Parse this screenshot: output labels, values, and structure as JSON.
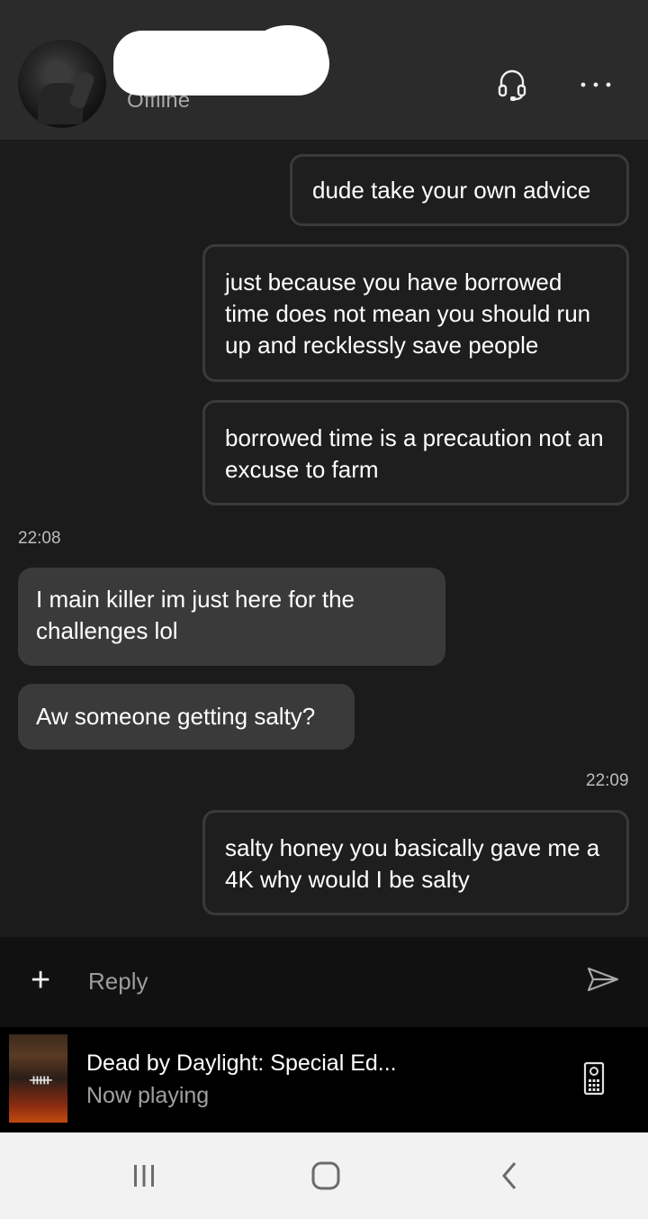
{
  "header": {
    "contact_status": "Offline"
  },
  "messages": [
    {
      "direction": "out",
      "text": "dude take your own advice"
    },
    {
      "direction": "out",
      "text": "just because you have borrowed time does not mean you should run up and recklessly save people"
    },
    {
      "direction": "out",
      "text": "borrowed time is a precaution not an excuse to farm"
    },
    {
      "timestamp": "22:08"
    },
    {
      "direction": "in",
      "text": "I main killer im just here for the challenges lol"
    },
    {
      "direction": "in",
      "text": "Aw someone getting salty?"
    },
    {
      "timestamp": "22:09"
    },
    {
      "direction": "out",
      "text": "salty honey you basically gave me a 4K why would I be salty"
    }
  ],
  "composer": {
    "add_icon": "+",
    "placeholder": "Reply"
  },
  "now_playing": {
    "title": "Dead by Daylight: Special Ed...",
    "status": "Now playing"
  },
  "icons": {
    "headset": "headset-icon",
    "more": "more-icon",
    "send": "send-icon",
    "remote": "remote-icon",
    "nav_recent": "recent-apps-icon",
    "nav_home": "home-icon",
    "nav_back": "back-icon"
  },
  "colors": {
    "header_bg": "#2b2b2b",
    "chat_bg": "#1b1b1b",
    "incoming_bubble": "#3a3a3a",
    "outgoing_border": "#3a3a3a"
  }
}
